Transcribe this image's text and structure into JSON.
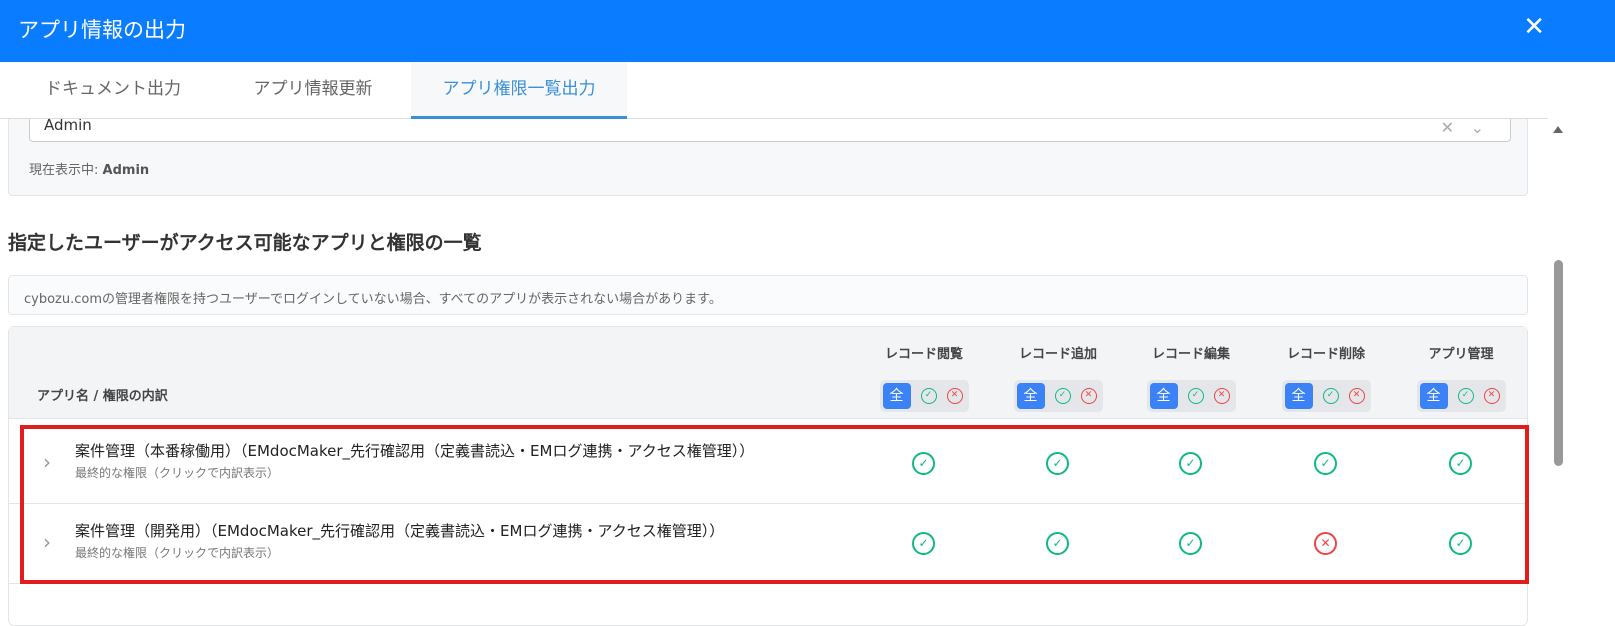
{
  "header": {
    "title": "アプリ情報の出力",
    "close": "✕"
  },
  "tabs": [
    {
      "label": "ドキュメント出力"
    },
    {
      "label": "アプリ情報更新"
    },
    {
      "label": "アプリ権限一覧出力",
      "active": true
    }
  ],
  "user_select": {
    "value": "Admin",
    "current_label": "現在表示中:",
    "current_value": "Admin"
  },
  "section_title": "指定したユーザーがアクセス可能なアプリと権限の一覧",
  "notice": "cybozu.comの管理者権限を持つユーザーでログインしていない場合、すべてのアプリが表示されない場合があります。",
  "table": {
    "name_header": "アプリ名 / 権限の内訳",
    "columns": [
      {
        "label": "レコード閲覧"
      },
      {
        "label": "レコード追加"
      },
      {
        "label": "レコード編集"
      },
      {
        "label": "レコード削除"
      },
      {
        "label": "アプリ管理"
      }
    ],
    "filter_all": "全",
    "rows": [
      {
        "name": "案件管理（本番稼働用）（EMdocMaker_先行確認用（定義書読込・EMログ連携・アクセス権管理））",
        "sub": "最終的な権限（クリックで内訳表示）",
        "perms": [
          true,
          true,
          true,
          true,
          true
        ]
      },
      {
        "name": "案件管理（開発用）（EMdocMaker_先行確認用（定義書読込・EMログ連携・アクセス権管理））",
        "sub": "最終的な権限（クリックで内訳表示）",
        "perms": [
          true,
          true,
          true,
          false,
          true
        ]
      }
    ]
  },
  "colors": {
    "header": "#0a7cff",
    "allowed": "#10b981",
    "denied": "#ef4444",
    "highlight": "#e11d1d",
    "tab_active": "#3a8fd6"
  }
}
